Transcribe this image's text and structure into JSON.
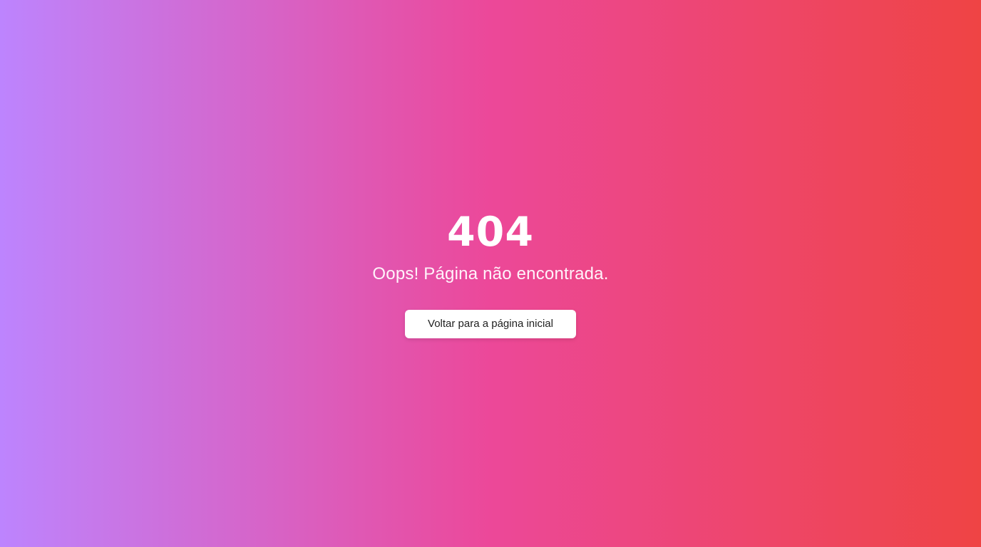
{
  "not_found": {
    "code": "404",
    "message": "Oops! Página não encontrada.",
    "home_button_label": "Voltar para a página inicial"
  },
  "colors": {
    "gradient_start": "#bd84fe",
    "gradient_mid": "#ec4899",
    "gradient_end": "#ef4444",
    "text": "#ffffff",
    "button_bg": "#ffffff",
    "button_text": "#1f1f1f"
  }
}
